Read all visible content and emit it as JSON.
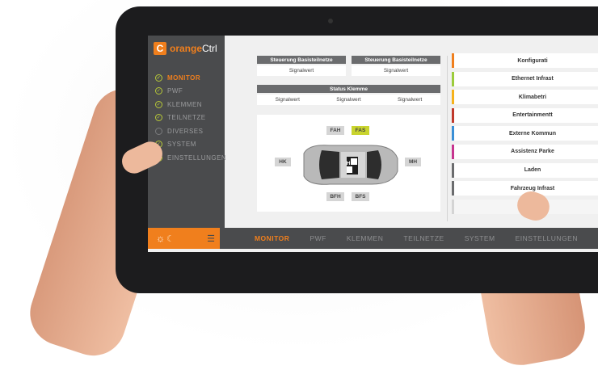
{
  "app": {
    "logo_letter": "C",
    "logo_prefix": "orange",
    "logo_suffix": "Ctrl",
    "accent": "#f07f1d",
    "ok_color": "#b7c838"
  },
  "sidebar": {
    "items": [
      {
        "label": "MONITOR",
        "icon": "check-circle-icon",
        "active": true
      },
      {
        "label": "PWF",
        "icon": "check-circle-icon"
      },
      {
        "label": "KLEMMEN",
        "icon": "check-circle-icon"
      },
      {
        "label": "TEILNETZE",
        "icon": "check-circle-icon"
      },
      {
        "label": "DIVERSES",
        "icon": "empty-circle-icon"
      },
      {
        "label": "SYSTEM",
        "icon": "check-circle-icon"
      },
      {
        "label": "EINSTELLUNGEN",
        "icon": "check-circle-icon"
      }
    ]
  },
  "panels": {
    "steuerung1": {
      "title": "Steuerung Basisteilnetze",
      "value": "Signalwert"
    },
    "steuerung2": {
      "title": "Steuerung Basisteilnetze",
      "value": "Signalwert"
    },
    "status": {
      "title": "Status Klemme",
      "values": [
        "Signalwert",
        "Signalwert",
        "Signalwert"
      ]
    }
  },
  "car": {
    "fah": "FAH",
    "fas": "FAS",
    "hk": "HK",
    "h": "H",
    "mh": "MH",
    "bfh": "BFH",
    "bfs": "BFS"
  },
  "right_list": [
    {
      "label": "Konfigurati",
      "color": "#f07f1d"
    },
    {
      "label": "Ethernet Infrast",
      "color": "#9ccc3c"
    },
    {
      "label": "Klimabetri",
      "color": "#f6b21b"
    },
    {
      "label": "Entertainmentt",
      "color": "#c0392b"
    },
    {
      "label": "Externe Kommun",
      "color": "#3a8fd6"
    },
    {
      "label": "Assistenz Parke",
      "color": "#c7358f"
    },
    {
      "label": "Laden",
      "color": "#6b6c6e"
    },
    {
      "label": "Fahrzeug Infrast",
      "color": "#6b6c6e"
    },
    {
      "label": "deaktivi",
      "color": "#d4d4d4",
      "disabled": true
    }
  ],
  "bottombar": {
    "tabs": [
      "MONITOR",
      "PWF",
      "KLEMMEN",
      "TEILNETZE",
      "SYSTEM",
      "EINSTELLUNGEN"
    ],
    "active": "MONITOR"
  }
}
